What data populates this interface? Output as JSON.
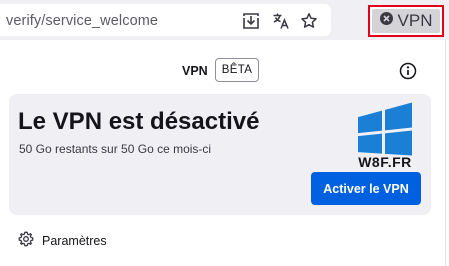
{
  "urlbar": {
    "url_text": "verify/service_welcome",
    "icons": [
      "download-page-icon",
      "translate-icon",
      "bookmark-star-icon"
    ]
  },
  "toolbar_vpn": {
    "label": "VPN",
    "icon": "vpn-off-icon",
    "highlight_color": "#e2001a"
  },
  "panel": {
    "title": "VPN",
    "badge": "BÊTA",
    "info_icon": "info-icon",
    "status": {
      "title": "Le VPN est désactivé",
      "quota": "50 Go restants sur 50 Go ce mois-ci",
      "action_label": "Activer le VPN",
      "action_color": "#0061e0"
    },
    "settings": {
      "icon": "gear-icon",
      "label": "Paramètres"
    }
  },
  "watermark": {
    "text": "W8F.FR"
  }
}
